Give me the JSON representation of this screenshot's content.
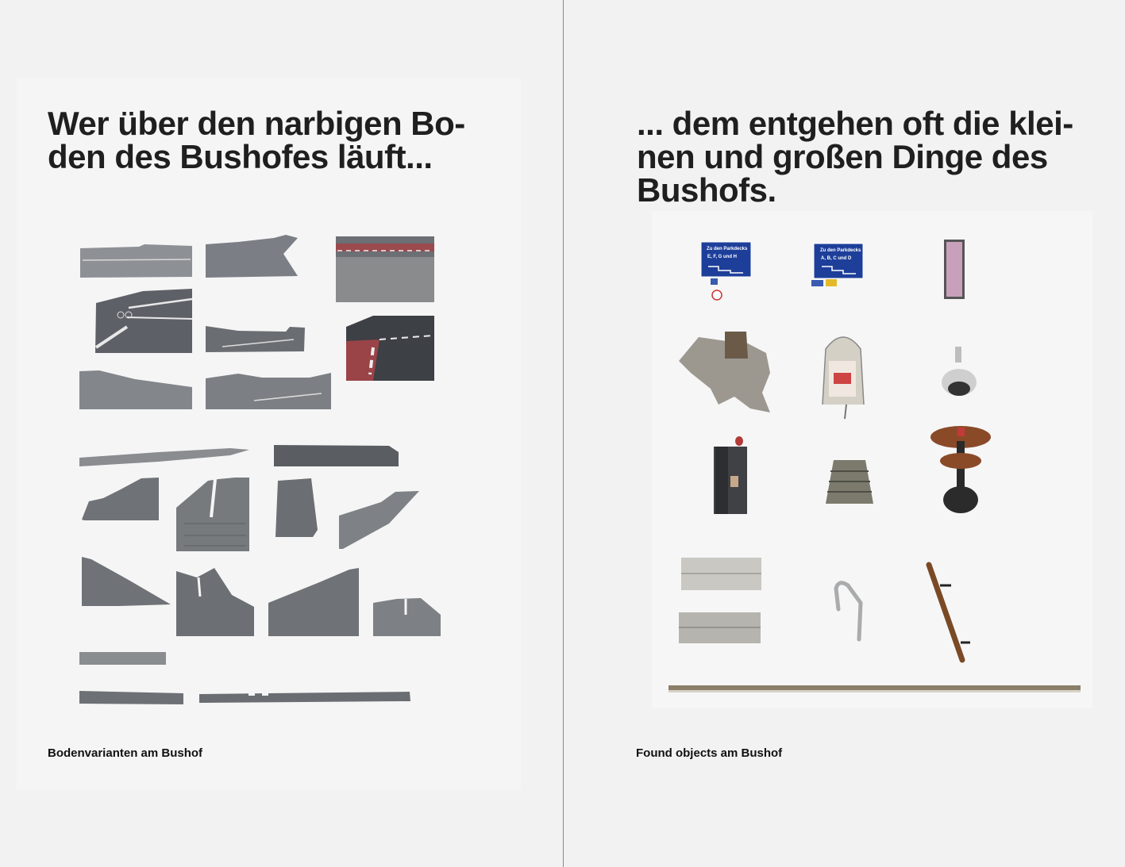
{
  "left_page": {
    "heading": "Wer über den narbigen Bo-\nden des Bushofes läuft...",
    "caption": "Bodenvarianten am Bushof"
  },
  "right_page": {
    "heading": "... dem entgehen oft die klei-\nnen und großen Dinge des\nBushofs.",
    "caption": "Found objects am Bushof",
    "sign_1": {
      "line1": "Zu den Parkdecks",
      "line2": "E, F, G und H"
    },
    "sign_2": {
      "line1": "Zu den Parkdecks",
      "line2": "A, B, C und D"
    }
  },
  "colors": {
    "background": "#f2f2f2",
    "sheet": "#f5f5f5",
    "text": "#1f1f1f",
    "sign_blue": "#1d3f9a"
  }
}
